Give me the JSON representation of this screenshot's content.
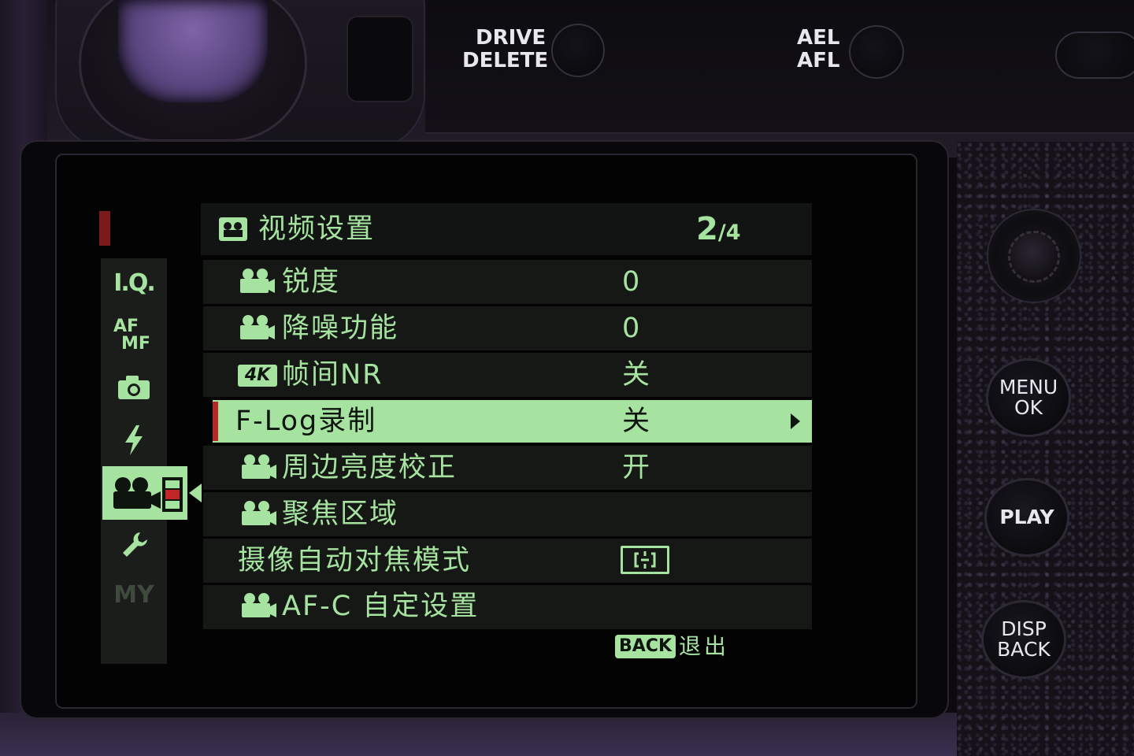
{
  "camera": {
    "drive_label_1": "DRIVE",
    "drive_label_2": "DELETE",
    "ael_label_1": "AEL",
    "ael_label_2": "AFL",
    "menu_btn_1": "MENU",
    "menu_btn_2": "OK",
    "play_btn": "PLAY",
    "disp_btn_1": "DISP",
    "disp_btn_2": "BACK"
  },
  "sidebar": {
    "items": [
      {
        "label": "I.Q.",
        "icon": "image-quality-icon"
      },
      {
        "label_top": "AF",
        "label_bottom": "MF",
        "icon": "af-mf-icon"
      },
      {
        "icon": "camera-icon"
      },
      {
        "icon": "flash-icon"
      },
      {
        "icon": "movie-camera-icon",
        "selected": true
      },
      {
        "icon": "wrench-icon"
      },
      {
        "label": "MY",
        "icon": "my-menu-icon"
      }
    ]
  },
  "header": {
    "title": "视频设置",
    "icon": "movie-settings-icon",
    "page_current": "2",
    "page_total": "/4"
  },
  "menu": {
    "rows": [
      {
        "label": "锐度",
        "value": "0",
        "icon": "movie-camera-icon"
      },
      {
        "label": "降噪功能",
        "value": "0",
        "icon": "movie-camera-icon"
      },
      {
        "label": "帧间NR",
        "value": "关",
        "icon": "4k-icon",
        "icon_text": "4K"
      },
      {
        "label": "F-Log录制",
        "value": "关",
        "selected": true,
        "has_submenu": true
      },
      {
        "label": "周边亮度校正",
        "value": "开",
        "icon": "movie-camera-icon"
      },
      {
        "label": "聚焦区域",
        "value": "",
        "icon": "movie-camera-icon"
      },
      {
        "label": "摄像自动对焦模式",
        "value": "",
        "value_icon": "af-area-mode-icon"
      },
      {
        "label": "AF-C 自定设置",
        "value": "",
        "icon": "movie-camera-icon"
      }
    ]
  },
  "footer": {
    "back_badge": "BACK",
    "back_label": "退出"
  },
  "colors": {
    "menu_green": "#a6e3a0",
    "accent_red": "#b42828",
    "screen_bg": "#030304"
  }
}
